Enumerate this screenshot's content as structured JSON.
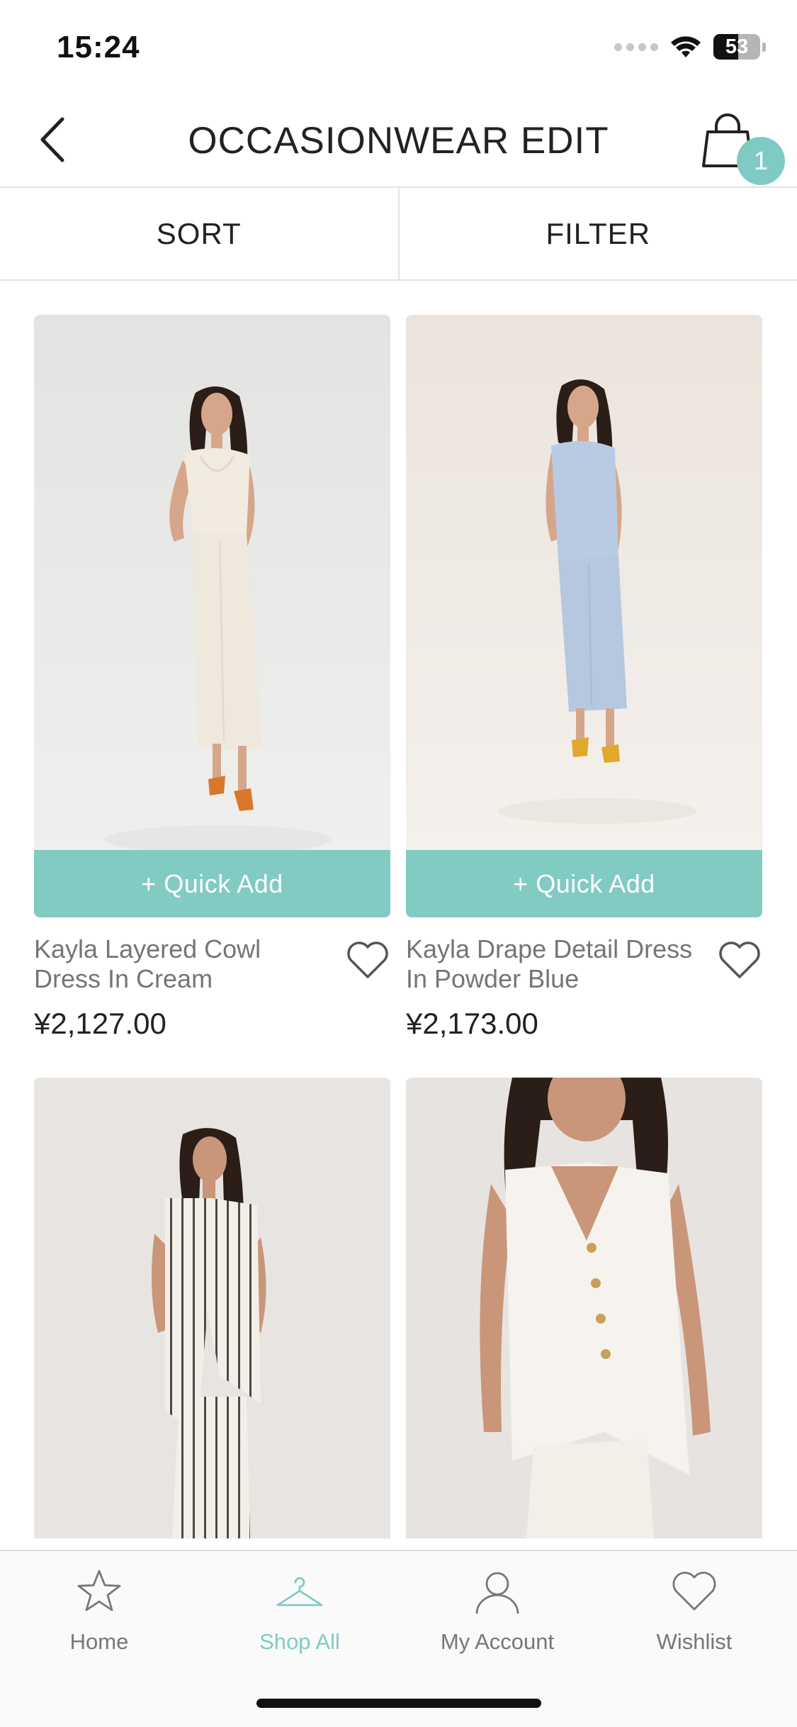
{
  "status_bar": {
    "time": "15:24",
    "battery": "53"
  },
  "header": {
    "title": "OCCASIONWEAR EDIT",
    "cart_count": "1"
  },
  "toolbar": {
    "sort_label": "SORT",
    "filter_label": "FILTER"
  },
  "products": [
    {
      "name": "Kayla Layered Cowl Dress In Cream",
      "price": "¥2,127.00",
      "quick_add": "+ Quick Add",
      "image": "woman-in-cream-cowl-dress"
    },
    {
      "name": "Kayla Drape Detail Dress In Powder Blue",
      "price": "¥2,173.00",
      "quick_add": "+ Quick Add",
      "image": "woman-in-powder-blue-dress"
    },
    {
      "image": "woman-in-striped-waistcoat-and-trousers"
    },
    {
      "image": "woman-in-white-buttoned-waistcoat"
    }
  ],
  "tabbar": {
    "items": [
      {
        "label": "Home",
        "icon": "star-icon"
      },
      {
        "label": "Shop All",
        "icon": "hanger-icon",
        "active": true
      },
      {
        "label": "My Account",
        "icon": "user-icon"
      },
      {
        "label": "Wishlist",
        "icon": "heart-icon"
      }
    ]
  },
  "colors": {
    "accent": "#81cbc3",
    "text": "#222222",
    "muted": "#757575"
  }
}
